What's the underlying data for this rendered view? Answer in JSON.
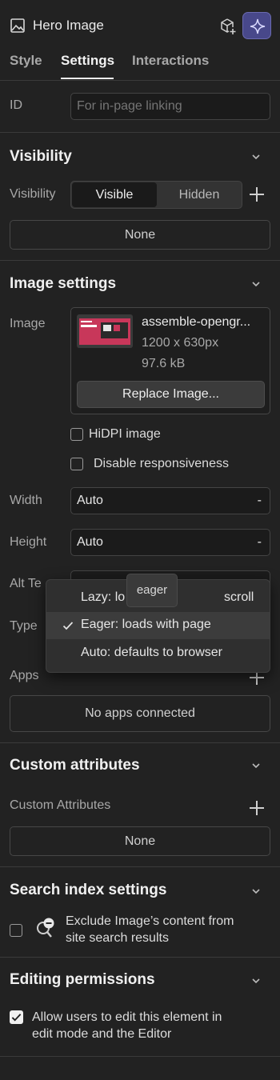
{
  "header": {
    "title": "Hero Image",
    "icons": [
      "image-icon",
      "add-component-icon",
      "ai-sparkle-icon"
    ]
  },
  "tabs": [
    {
      "label": "Style",
      "active": false
    },
    {
      "label": "Settings",
      "active": true
    },
    {
      "label": "Interactions",
      "active": false
    }
  ],
  "id_field": {
    "label": "ID",
    "placeholder": "For in-page linking"
  },
  "visibility": {
    "section_title": "Visibility",
    "label": "Visibility",
    "options": [
      "Visible",
      "Hidden"
    ],
    "selected": "Visible",
    "conditions": "None"
  },
  "image_settings": {
    "section_title": "Image settings",
    "image_label": "Image",
    "file_name": "assemble-opengr...",
    "dimensions": "1200 x 630px",
    "size": "97.6 kB",
    "replace_button": "Replace Image...",
    "hidpi_label": "HiDPI image",
    "disable_responsive_label": "Disable responsiveness",
    "width_label": "Width",
    "width_value": "Auto",
    "height_label": "Height",
    "height_value": "Auto",
    "unit_symbol": "-",
    "alt_label": "Alt Te",
    "type_label": "Type"
  },
  "loading_dropdown": {
    "tooltip": "eager",
    "options": [
      {
        "label": "Lazy: lo",
        "label_tail": "scroll",
        "checked": false
      },
      {
        "label": "Eager: loads with page",
        "checked": true
      },
      {
        "label": "Auto: defaults to browser",
        "checked": false
      }
    ]
  },
  "apps": {
    "label": "Apps",
    "empty": "No apps connected"
  },
  "custom_attributes": {
    "section_title": "Custom attributes",
    "label": "Custom Attributes",
    "empty": "None"
  },
  "search_index": {
    "section_title": "Search index settings",
    "exclude_line1": "Exclude Image’s content from",
    "exclude_line2": "site search results",
    "exclude_checked": false
  },
  "editing_permissions": {
    "section_title": "Editing permissions",
    "allow_line1": "Allow users to edit this element in",
    "allow_line2": "edit mode and the Editor",
    "allow_checked": true
  },
  "colors": {
    "background": "#222222",
    "accent_purple": "#4a4a8a",
    "thumb_pink": "#c8375a"
  }
}
